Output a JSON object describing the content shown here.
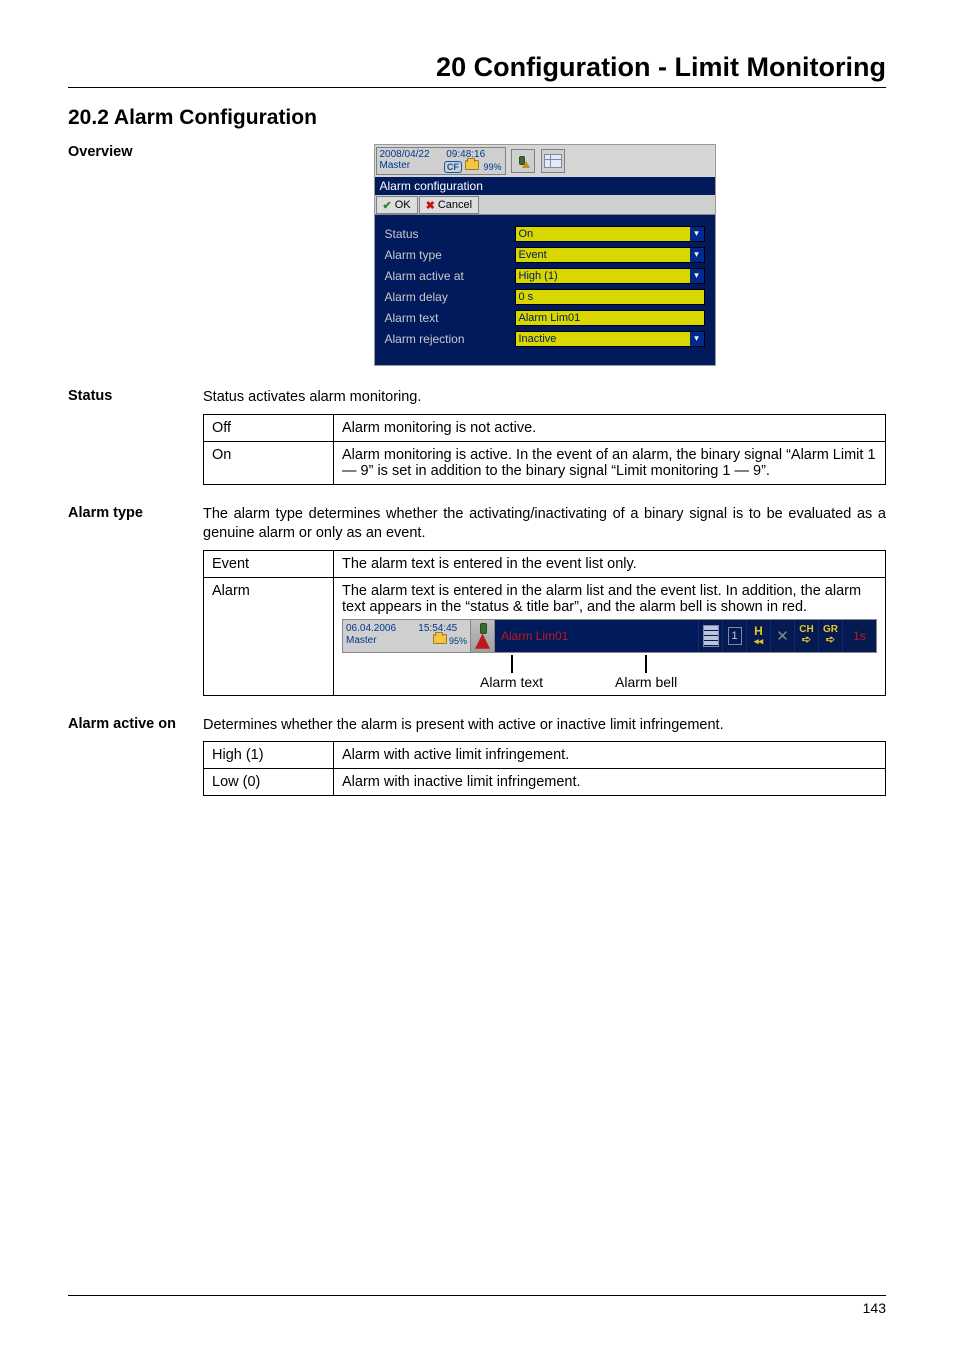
{
  "chapter_title": "20 Configuration - Limit Monitoring",
  "section_title": "20.2   Alarm Configuration",
  "overview_label": "Overview",
  "page_number": "143",
  "shot1": {
    "date": "2008/04/22",
    "time": "09:48:16",
    "master": "Master",
    "cf": "CF",
    "pct": "99%",
    "titlebar": "Alarm configuration",
    "ok": "OK",
    "cancel": "Cancel",
    "rows": {
      "status_lab": "Status",
      "status_val": "On",
      "type_lab": "Alarm type",
      "type_val": "Event",
      "active_lab": "Alarm active at",
      "active_val": "High (1)",
      "delay_lab": "Alarm delay",
      "delay_val": "0 s",
      "text_lab": "Alarm text",
      "text_val": "Alarm Lim01",
      "rej_lab": "Alarm rejection",
      "rej_val": "Inactive"
    }
  },
  "status": {
    "label": "Status",
    "intro": "Status activates alarm monitoring.",
    "rows": [
      {
        "k": "Off",
        "v": "Alarm monitoring is not active."
      },
      {
        "k": "On",
        "v": "Alarm monitoring is active. In the event of an alarm, the binary signal “Alarm Limit 1 — 9” is set in addition to the binary signal “Limit monitoring 1 — 9”."
      }
    ]
  },
  "alarm_type": {
    "label": "Alarm type",
    "intro": "The alarm type determines whether the activating/inactivating of a binary signal is to be evaluated as a genuine alarm or only as an event.",
    "rows": [
      {
        "k": "Event",
        "v": "The alarm text is entered in the event list only."
      },
      {
        "k": "Alarm",
        "v": "The alarm text is entered in the alarm list and the event list. In addition, the alarm text appears in the “status & title bar”, and the alarm bell is shown in red."
      }
    ],
    "bar": {
      "date": "06.04.2006",
      "time": "15:54:45",
      "master": "Master",
      "pct": "95%",
      "text": "Alarm Lim01",
      "onesec": "1s",
      "one": "1",
      "h": "H",
      "hh_small": "◂◂",
      "ch": "CH",
      "gr": "GR"
    },
    "callouts": {
      "text": "Alarm text",
      "bell": "Alarm bell"
    }
  },
  "active_on": {
    "label": "Alarm active on",
    "intro": "Determines whether the alarm is present with active or inactive limit infringement.",
    "rows": [
      {
        "k": "High (1)",
        "v": "Alarm with active limit infringement."
      },
      {
        "k": "Low (0)",
        "v": "Alarm with inactive limit infringement."
      }
    ]
  }
}
